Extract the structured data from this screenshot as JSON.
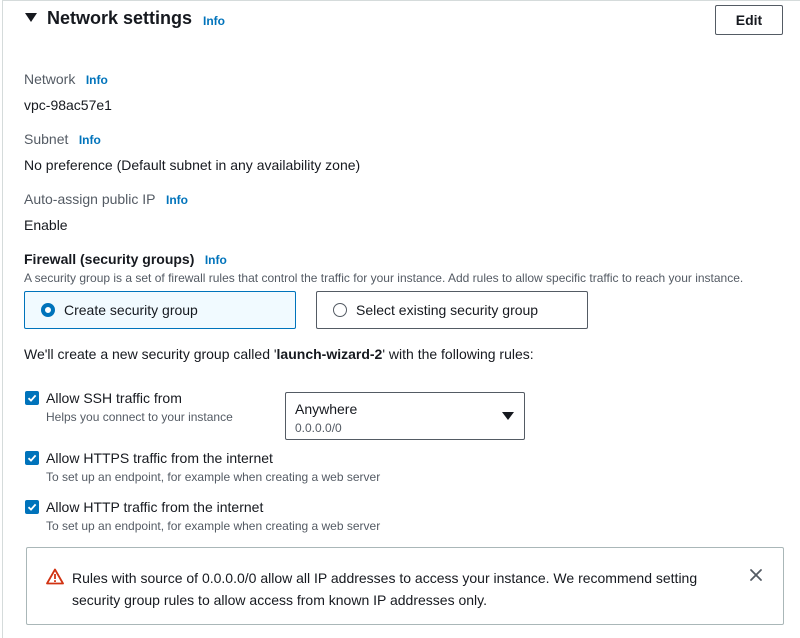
{
  "header": {
    "title": "Network settings",
    "info": "Info",
    "edit_label": "Edit"
  },
  "network": {
    "label": "Network",
    "info": "Info",
    "value": "vpc-98ac57e1"
  },
  "subnet": {
    "label": "Subnet",
    "info": "Info",
    "value": "No preference (Default subnet in any availability zone)"
  },
  "public_ip": {
    "label": "Auto-assign public IP",
    "info": "Info",
    "value": "Enable"
  },
  "firewall": {
    "title": "Firewall (security groups)",
    "info": "Info",
    "description": "A security group is a set of firewall rules that control the traffic for your instance. Add rules to allow specific traffic to reach your instance.",
    "options": [
      {
        "label": "Create security group",
        "selected": true
      },
      {
        "label": "Select existing security group",
        "selected": false
      }
    ],
    "note_prefix": "We'll create a new security group called '",
    "group_name": "launch-wizard-2",
    "note_suffix": "' with the following rules:"
  },
  "rules": [
    {
      "title": "Allow SSH traffic from",
      "desc": "Helps you connect to your instance",
      "checked": true
    },
    {
      "title": "Allow HTTPS traffic from the internet",
      "desc": "To set up an endpoint, for example when creating a web server",
      "checked": true
    },
    {
      "title": "Allow HTTP traffic from the internet",
      "desc": "To set up an endpoint, for example when creating a web server",
      "checked": true
    }
  ],
  "ssh_source": {
    "value": "Anywhere",
    "desc": "0.0.0.0/0"
  },
  "alert": {
    "text": "Rules with source of 0.0.0.0/0 allow all IP addresses to access your instance. We recommend setting security group rules to allow access from known IP addresses only.",
    "icon": "warning-icon",
    "close_icon": "close-icon"
  },
  "colors": {
    "accent": "#0073bb",
    "warning": "#d13212",
    "text": "#16191f",
    "muted": "#545b64"
  }
}
